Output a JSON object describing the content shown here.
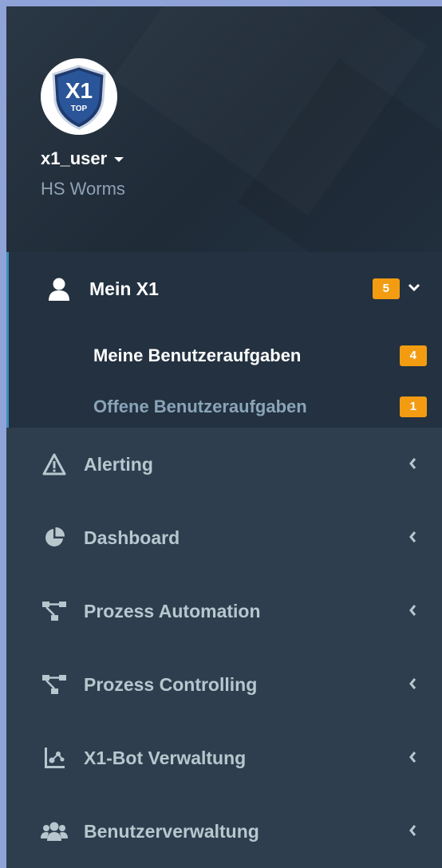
{
  "profile": {
    "avatar_text": "X1",
    "avatar_subtext": "TOP",
    "username": "x1_user",
    "organization": "HS Worms"
  },
  "menu": {
    "active": {
      "label": "Mein X1",
      "icon": "user-icon",
      "badge": "5",
      "chevron": "down",
      "children": [
        {
          "label": "Meine Benutzeraufgaben",
          "badge": "4",
          "active": true
        },
        {
          "label": "Offene Benutzeraufgaben",
          "badge": "1",
          "active": false
        }
      ]
    },
    "items": [
      {
        "label": "Alerting",
        "icon": "warning-icon"
      },
      {
        "label": "Dashboard",
        "icon": "pie-chart-icon"
      },
      {
        "label": "Prozess Automation",
        "icon": "sitemap-icon"
      },
      {
        "label": "Prozess Controlling",
        "icon": "sitemap-icon"
      },
      {
        "label": "X1-Bot Verwaltung",
        "icon": "bot-network-icon"
      },
      {
        "label": "Benutzerverwaltung",
        "icon": "users-icon"
      }
    ]
  },
  "colors": {
    "sidebar_bg": "#2f3e4e",
    "active_bg": "#233140",
    "active_border": "#3c8dbc",
    "badge": "#f39c12",
    "text_muted": "#b8c7ce",
    "page_bg": "#8fa3d9"
  }
}
